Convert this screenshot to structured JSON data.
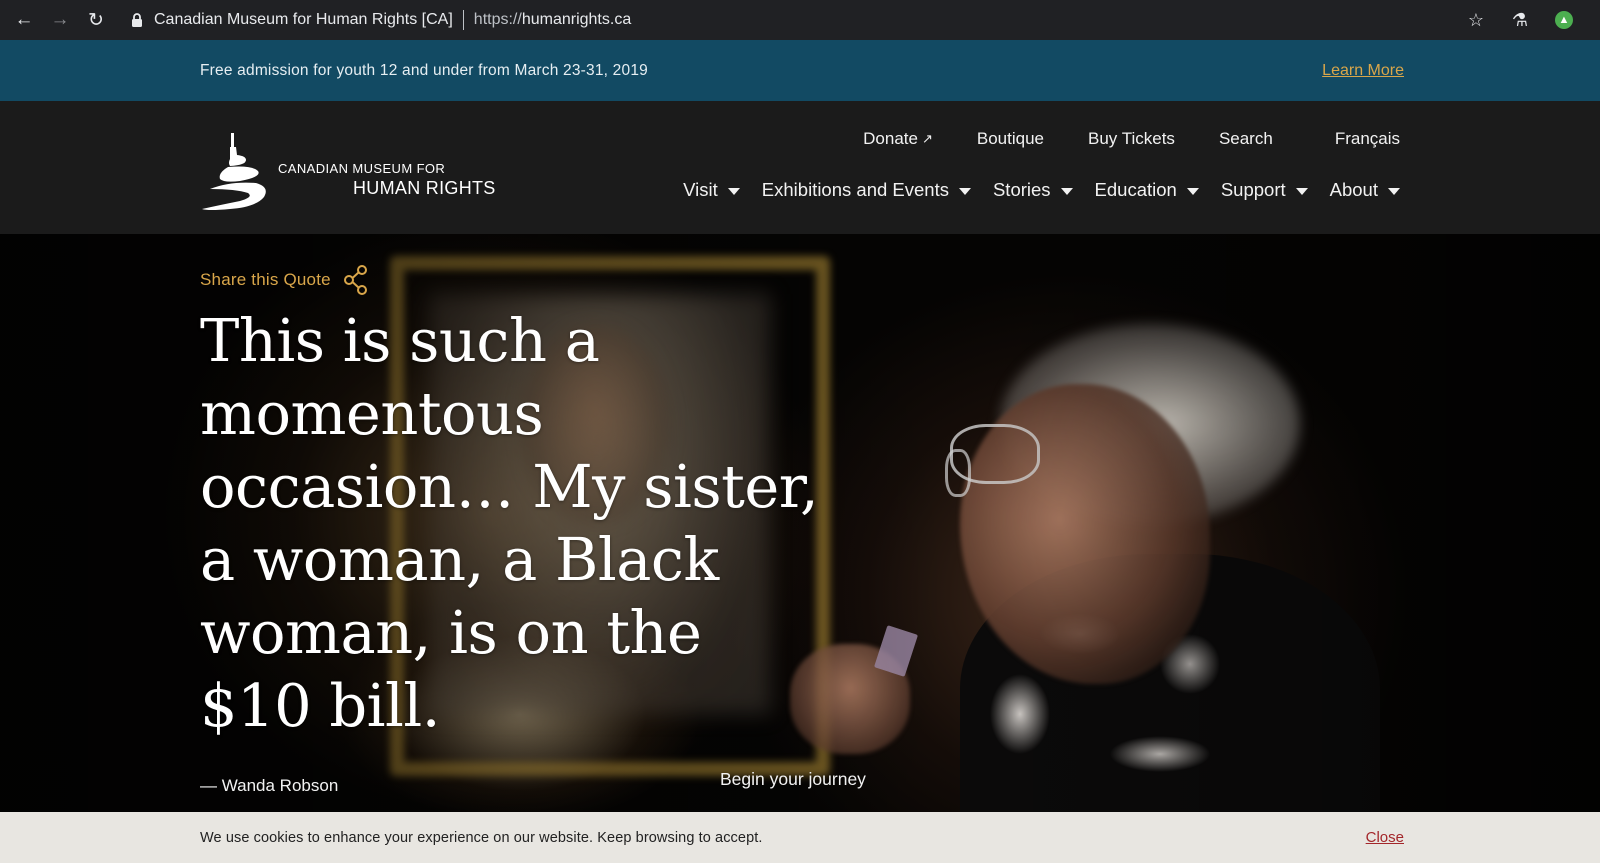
{
  "browser": {
    "site_name": "Canadian Museum for Human Rights [CA]",
    "url_scheme": "https://",
    "url_host": "humanrights.ca"
  },
  "announcement": {
    "text": "Free admission for youth 12 and under from March 23-31, 2019",
    "link_label": "Learn More",
    "background": "#124a63",
    "link_color": "#d9a64a"
  },
  "logo": {
    "line1": "CANADIAN MUSEUM FOR",
    "line2": "HUMAN RIGHTS"
  },
  "utility_nav": [
    {
      "label": "Donate",
      "icon": "external-arrow-icon"
    },
    {
      "label": "Boutique"
    },
    {
      "label": "Buy Tickets"
    },
    {
      "label": "Search"
    },
    {
      "label": "Français"
    }
  ],
  "main_nav": [
    {
      "label": "Visit"
    },
    {
      "label": "Exhibitions and Events"
    },
    {
      "label": "Stories"
    },
    {
      "label": "Education"
    },
    {
      "label": "Support"
    },
    {
      "label": "About"
    }
  ],
  "hero": {
    "share_label": "Share this Quote",
    "quote": "This is such a momentous occasion… My sister, a woman, a Black woman, is on the $10 bill.",
    "author": "— Wanda Robson",
    "cta": "Begin your journey",
    "accent_color": "#d9a64a"
  },
  "cookie_banner": {
    "text": "We use cookies to enhance your experience on our website. Keep browsing to accept.",
    "close_label": "Close",
    "close_color": "#a3262a"
  }
}
